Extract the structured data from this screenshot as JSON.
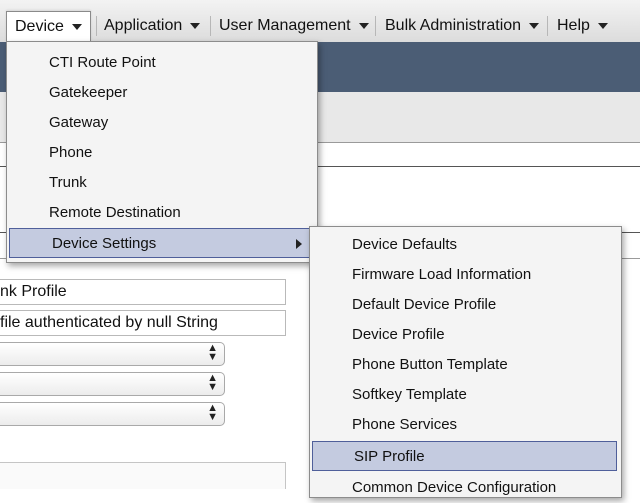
{
  "menubar": {
    "items": [
      {
        "label": "Device"
      },
      {
        "label": "Application"
      },
      {
        "label": "User Management"
      },
      {
        "label": "Bulk Administration"
      },
      {
        "label": "Help"
      }
    ]
  },
  "device_menu": {
    "items": [
      "CTI Route Point",
      "Gatekeeper",
      "Gateway",
      "Phone",
      "Trunk",
      "Remote Destination",
      "Device Settings"
    ]
  },
  "device_settings_menu": {
    "items": [
      "Device Defaults",
      "Firmware Load Information",
      "Default Device Profile",
      "Device Profile",
      "Phone Button Template",
      "Softkey Template",
      "Phone Services",
      "SIP Profile",
      "Common Device Configuration"
    ]
  },
  "background_form": {
    "name_value": "nk Profile",
    "description_value": "file authenticated by null String"
  },
  "colors": {
    "header_band": "#4b5d75",
    "selected_item": "#c4cbe0",
    "selected_border": "#4f5f9a"
  }
}
